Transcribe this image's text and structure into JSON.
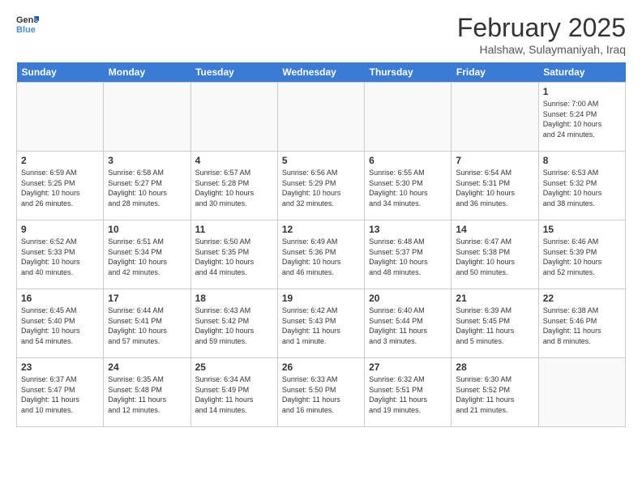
{
  "header": {
    "logo_general": "General",
    "logo_blue": "Blue",
    "month": "February 2025",
    "location": "Halshaw, Sulaymaniyah, Iraq"
  },
  "days_of_week": [
    "Sunday",
    "Monday",
    "Tuesday",
    "Wednesday",
    "Thursday",
    "Friday",
    "Saturday"
  ],
  "weeks": [
    [
      {
        "day": "",
        "info": ""
      },
      {
        "day": "",
        "info": ""
      },
      {
        "day": "",
        "info": ""
      },
      {
        "day": "",
        "info": ""
      },
      {
        "day": "",
        "info": ""
      },
      {
        "day": "",
        "info": ""
      },
      {
        "day": "1",
        "info": "Sunrise: 7:00 AM\nSunset: 5:24 PM\nDaylight: 10 hours\nand 24 minutes."
      }
    ],
    [
      {
        "day": "2",
        "info": "Sunrise: 6:59 AM\nSunset: 5:25 PM\nDaylight: 10 hours\nand 26 minutes."
      },
      {
        "day": "3",
        "info": "Sunrise: 6:58 AM\nSunset: 5:27 PM\nDaylight: 10 hours\nand 28 minutes."
      },
      {
        "day": "4",
        "info": "Sunrise: 6:57 AM\nSunset: 5:28 PM\nDaylight: 10 hours\nand 30 minutes."
      },
      {
        "day": "5",
        "info": "Sunrise: 6:56 AM\nSunset: 5:29 PM\nDaylight: 10 hours\nand 32 minutes."
      },
      {
        "day": "6",
        "info": "Sunrise: 6:55 AM\nSunset: 5:30 PM\nDaylight: 10 hours\nand 34 minutes."
      },
      {
        "day": "7",
        "info": "Sunrise: 6:54 AM\nSunset: 5:31 PM\nDaylight: 10 hours\nand 36 minutes."
      },
      {
        "day": "8",
        "info": "Sunrise: 6:53 AM\nSunset: 5:32 PM\nDaylight: 10 hours\nand 38 minutes."
      }
    ],
    [
      {
        "day": "9",
        "info": "Sunrise: 6:52 AM\nSunset: 5:33 PM\nDaylight: 10 hours\nand 40 minutes."
      },
      {
        "day": "10",
        "info": "Sunrise: 6:51 AM\nSunset: 5:34 PM\nDaylight: 10 hours\nand 42 minutes."
      },
      {
        "day": "11",
        "info": "Sunrise: 6:50 AM\nSunset: 5:35 PM\nDaylight: 10 hours\nand 44 minutes."
      },
      {
        "day": "12",
        "info": "Sunrise: 6:49 AM\nSunset: 5:36 PM\nDaylight: 10 hours\nand 46 minutes."
      },
      {
        "day": "13",
        "info": "Sunrise: 6:48 AM\nSunset: 5:37 PM\nDaylight: 10 hours\nand 48 minutes."
      },
      {
        "day": "14",
        "info": "Sunrise: 6:47 AM\nSunset: 5:38 PM\nDaylight: 10 hours\nand 50 minutes."
      },
      {
        "day": "15",
        "info": "Sunrise: 6:46 AM\nSunset: 5:39 PM\nDaylight: 10 hours\nand 52 minutes."
      }
    ],
    [
      {
        "day": "16",
        "info": "Sunrise: 6:45 AM\nSunset: 5:40 PM\nDaylight: 10 hours\nand 54 minutes."
      },
      {
        "day": "17",
        "info": "Sunrise: 6:44 AM\nSunset: 5:41 PM\nDaylight: 10 hours\nand 57 minutes."
      },
      {
        "day": "18",
        "info": "Sunrise: 6:43 AM\nSunset: 5:42 PM\nDaylight: 10 hours\nand 59 minutes."
      },
      {
        "day": "19",
        "info": "Sunrise: 6:42 AM\nSunset: 5:43 PM\nDaylight: 11 hours\nand 1 minute."
      },
      {
        "day": "20",
        "info": "Sunrise: 6:40 AM\nSunset: 5:44 PM\nDaylight: 11 hours\nand 3 minutes."
      },
      {
        "day": "21",
        "info": "Sunrise: 6:39 AM\nSunset: 5:45 PM\nDaylight: 11 hours\nand 5 minutes."
      },
      {
        "day": "22",
        "info": "Sunrise: 6:38 AM\nSunset: 5:46 PM\nDaylight: 11 hours\nand 8 minutes."
      }
    ],
    [
      {
        "day": "23",
        "info": "Sunrise: 6:37 AM\nSunset: 5:47 PM\nDaylight: 11 hours\nand 10 minutes."
      },
      {
        "day": "24",
        "info": "Sunrise: 6:35 AM\nSunset: 5:48 PM\nDaylight: 11 hours\nand 12 minutes."
      },
      {
        "day": "25",
        "info": "Sunrise: 6:34 AM\nSunset: 5:49 PM\nDaylight: 11 hours\nand 14 minutes."
      },
      {
        "day": "26",
        "info": "Sunrise: 6:33 AM\nSunset: 5:50 PM\nDaylight: 11 hours\nand 16 minutes."
      },
      {
        "day": "27",
        "info": "Sunrise: 6:32 AM\nSunset: 5:51 PM\nDaylight: 11 hours\nand 19 minutes."
      },
      {
        "day": "28",
        "info": "Sunrise: 6:30 AM\nSunset: 5:52 PM\nDaylight: 11 hours\nand 21 minutes."
      },
      {
        "day": "",
        "info": ""
      }
    ]
  ]
}
